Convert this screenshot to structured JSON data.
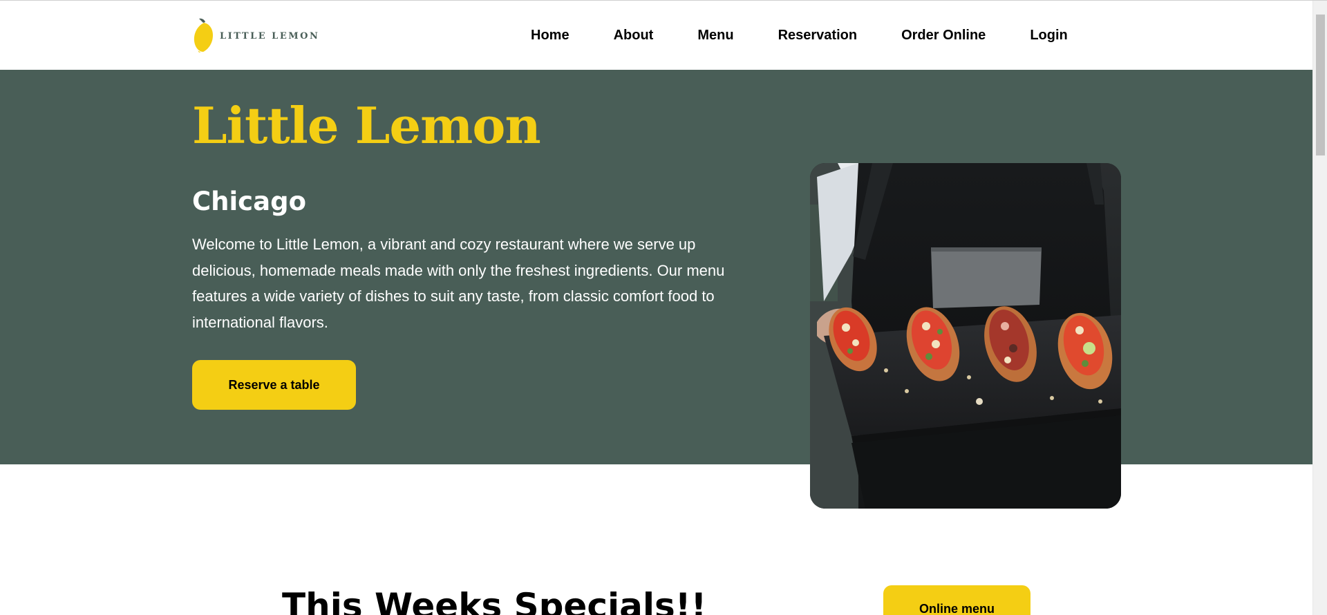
{
  "header": {
    "logo_text": "LITTLE LEMON",
    "nav": [
      {
        "label": "Home"
      },
      {
        "label": "About"
      },
      {
        "label": "Menu"
      },
      {
        "label": "Reservation"
      },
      {
        "label": "Order Online"
      },
      {
        "label": "Login"
      }
    ]
  },
  "hero": {
    "title": "Little Lemon",
    "subtitle": "Chicago",
    "description": "Welcome to Little Lemon, a vibrant and cozy restaurant where we serve up delicious, homemade meals made with only the freshest ingredients. Our menu features a wide variety of dishes to suit any taste, from classic comfort food to international flavors.",
    "reserve_label": "Reserve a table",
    "image_icon": "restaurant-food-photo"
  },
  "specials": {
    "title": "This Weeks Specials!!",
    "online_menu_label": "Online menu"
  },
  "colors": {
    "primary_green": "#495e57",
    "primary_yellow": "#f4ce14",
    "white": "#ffffff",
    "black": "#000000"
  }
}
